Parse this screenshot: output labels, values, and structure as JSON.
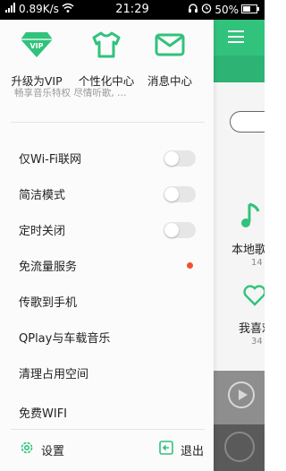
{
  "status_bar": {
    "speed": "0.89K/s",
    "time": "21:29",
    "battery": "50%",
    "icons": [
      "signal-icon",
      "wifi-icon",
      "headset-icon",
      "alarm-icon",
      "battery-icon"
    ]
  },
  "drawer": {
    "top_items": [
      {
        "label": "升级为VIP",
        "icon": "vip-diamond-icon"
      },
      {
        "label": "个性化中心",
        "icon": "tshirt-icon"
      },
      {
        "label": "消息中心",
        "icon": "mail-icon"
      }
    ],
    "vip_subtitle": "畅享音乐特权 尽情听歌, …",
    "menu": [
      {
        "label": "仅Wi-Fi联网",
        "control": "toggle",
        "on": false
      },
      {
        "label": "简洁模式",
        "control": "toggle",
        "on": false
      },
      {
        "label": "定时关闭",
        "control": "toggle",
        "on": false
      },
      {
        "label": "免流量服务",
        "control": "dot"
      },
      {
        "label": "传歌到手机"
      },
      {
        "label": "QPlay与车载音乐"
      },
      {
        "label": "清理占用空间"
      },
      {
        "label": "免费WIFI"
      }
    ],
    "settings_label": "设置",
    "exit_label": "退出"
  },
  "background": {
    "local_label": "本地歌",
    "local_count": "14",
    "fav_label": "我喜欢",
    "fav_count": "34"
  },
  "colors": {
    "accent_green": "#31c27c",
    "notice_red": "#f4502e"
  }
}
